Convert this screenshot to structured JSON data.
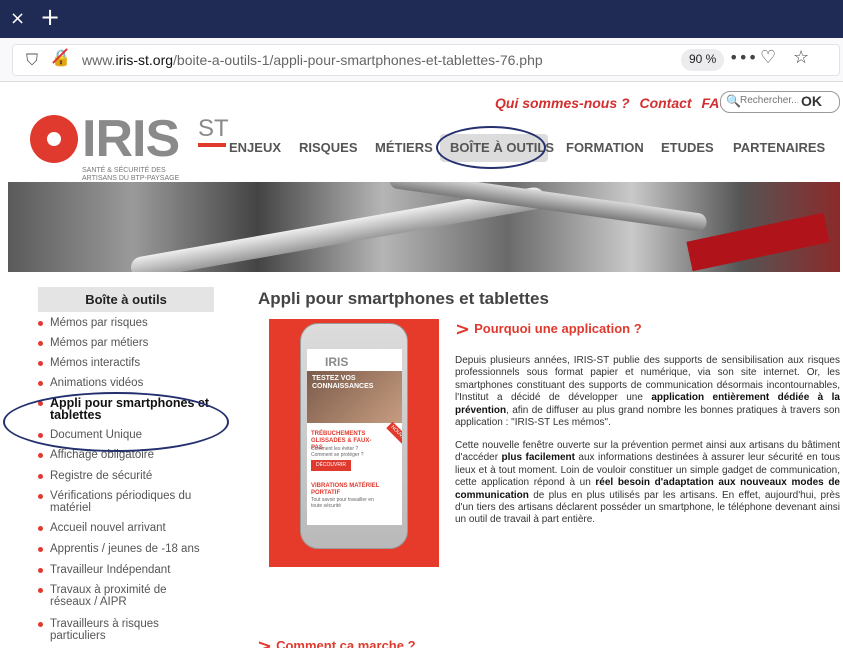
{
  "browser": {
    "tab_close": "×",
    "tab_new": "+",
    "url_prefix": "www.",
    "url_host": "iris-st.org",
    "url_path": "/boite-a-outils-1/appli-pour-smartphones-et-tablettes-76.php",
    "zoom": "90 %"
  },
  "header": {
    "logo_word": "IRIS",
    "logo_st": "ST",
    "logo_tagline": "SANTÉ & SÉCURITÉ DES ARTISANS DU BTP-PAYSAGE",
    "top_links": [
      "Qui sommes-nous ?",
      "Contact",
      "FAQ"
    ],
    "search_placeholder": "Rechercher...",
    "search_ok": "OK",
    "nav": [
      "ENJEUX",
      "RISQUES",
      "MÉTIERS",
      "BOÎTE À OUTILS",
      "FORMATION",
      "ETUDES",
      "PARTENAIRES"
    ]
  },
  "sidebar": {
    "title": "Boîte à outils",
    "items": [
      "Mémos par risques",
      "Mémos par métiers",
      "Mémos interactifs",
      "Animations vidéos",
      "Appli pour smartphones et tablettes",
      "Document Unique",
      "Affichage obligatoire",
      "Registre de sécurité",
      "Vérifications périodiques du matériel",
      "Accueil nouvel arrivant",
      "Apprentis / jeunes de -18 ans",
      "Travailleur Indépendant",
      "Travaux à proximité de réseaux / AIPR",
      "Travailleurs à risques particuliers"
    ]
  },
  "main": {
    "title": "Appli pour smartphones et tablettes",
    "section1_title": "Pourquoi une application ?",
    "p1_a": "Depuis plusieurs années, IRIS-ST publie des supports de sensibilisation aux risques professionnels sous format papier et numérique, via son site internet. Or, les smartphones constituant des supports de communication désormais incontournables, l'Institut a décidé de développer une ",
    "p1_b": "application entièrement dédiée à la prévention",
    "p1_c": ", afin de diffuser au plus grand nombre les bonnes pratiques à travers son application : \"IRIS-ST Les mémos\".",
    "p2_a": "Cette nouvelle fenêtre ouverte sur la prévention permet ainsi aux artisans du bâtiment d'accéder ",
    "p2_b": "plus facilement",
    "p2_c": " aux informations destinées à assurer leur sécurité en tous lieux et à tout moment. Loin de vouloir constituer un simple gadget de communication, cette application répond à un ",
    "p2_d": "réel besoin d'adaptation aux nouveaux modes de communication",
    "p2_e": " de plus en plus utilisés par les artisans. En effet, aujourd'hui, près d'un tiers des artisans déclarent posséder un smartphone, le téléphone devenant ainsi un outil de travail à part entière.",
    "section2_title": "Comment ça marche ?"
  },
  "phone": {
    "logo": "IRIS",
    "hero": "TESTEZ VOS CONNAISSANCES",
    "card1_title": "TRÉBUCHEMENTS GLISSADES & FAUX-PAS",
    "card1_sub": "Comment les éviter ? Comment se protéger ?",
    "card1_btn": "DÉCOUVRIR",
    "ribbon": "NOUVEAU",
    "card2_title": "VIBRATIONS MATÉRIEL PORTATIF",
    "card2_sub": "Tout savoir pour travailler en toute sécurité"
  }
}
